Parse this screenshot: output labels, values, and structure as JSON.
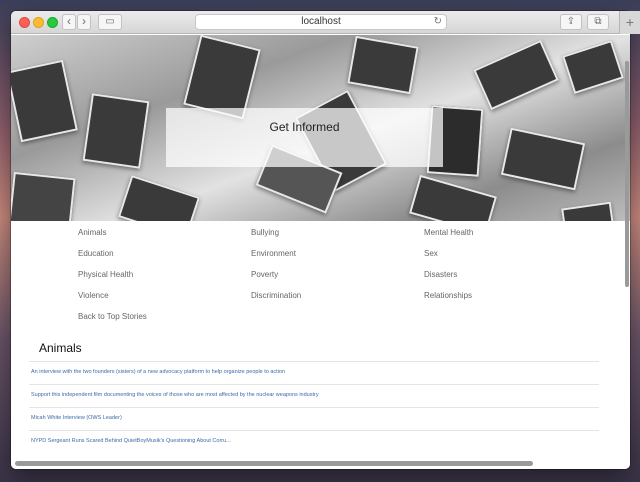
{
  "browser": {
    "url": "localhost",
    "back_glyph": "‹",
    "forward_glyph": "›",
    "reload_glyph": "↻",
    "share_glyph": "⇪",
    "tabs_glyph": "⧉",
    "sidebar_glyph": "▭",
    "new_tab_glyph": "+"
  },
  "hero": {
    "title": "Get Informed"
  },
  "topics": [
    "Animals",
    "Bullying",
    "Mental Health",
    "Education",
    "Environment",
    "Sex",
    "Physical Health",
    "Poverty",
    "Disasters",
    "Violence",
    "Discrimination",
    "Relationships",
    "Back to Top Stories"
  ],
  "section": {
    "title": "Animals",
    "stories": [
      "An interview with the two founders (sisters) of a new advocacy platform to help organize people to action",
      "Support this independent film documenting the voices of those who are most affected by the nuclear weapons industry",
      "Micah White Interview (OWS Leader)",
      "NYPD Sergeant Runs Scared Behind QuietBoyMusik's Questioning About Corru..."
    ]
  }
}
